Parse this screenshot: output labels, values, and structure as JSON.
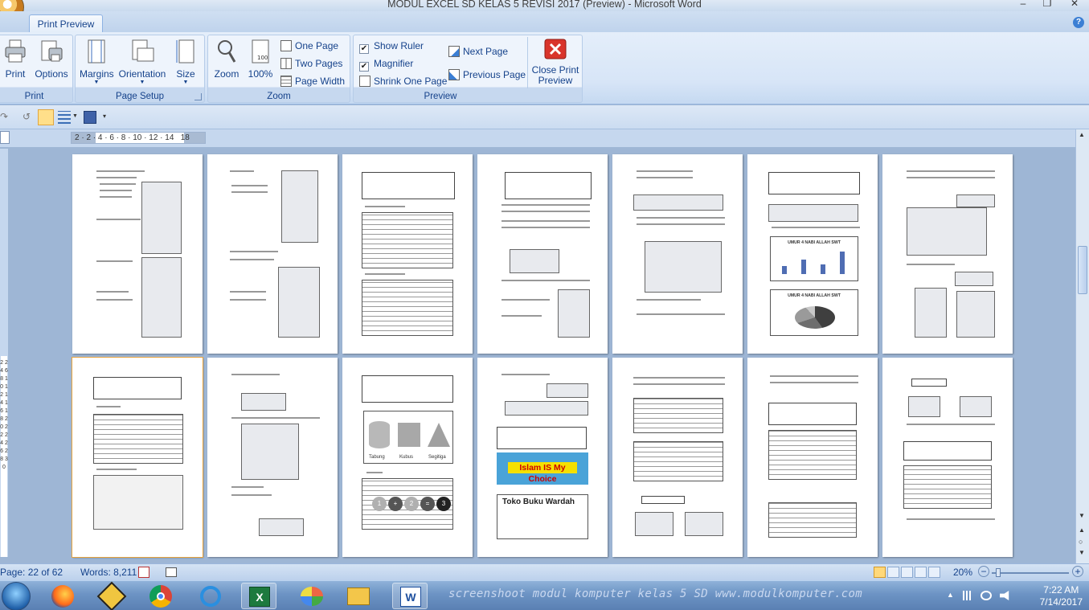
{
  "window": {
    "title": "MODUL EXCEL SD KELAS 5 REVISI 2017 (Preview) - Microsoft Word",
    "minimize": "–",
    "maximize": "❐",
    "close": "✕"
  },
  "ribbon": {
    "active_tab": "Print Preview",
    "help": "?",
    "groups": {
      "print": {
        "label": "Print",
        "print_button": "Print",
        "options_button": "Options"
      },
      "page_setup": {
        "label": "Page Setup",
        "margins": "Margins",
        "orientation": "Orientation",
        "size": "Size"
      },
      "zoom": {
        "label": "Zoom",
        "zoom": "Zoom",
        "percent_100": "100%",
        "one_page": "One Page",
        "two_pages": "Two Pages",
        "page_width": "Page Width"
      },
      "preview": {
        "label": "Preview",
        "show_ruler": "Show Ruler",
        "show_ruler_checked": true,
        "magnifier": "Magnifier",
        "magnifier_checked": true,
        "shrink_one_page": "Shrink One Page",
        "next_page": "Next Page",
        "previous_page": "Previous Page",
        "close_print_preview_1": "Close Print",
        "close_print_preview_2": "Preview"
      }
    }
  },
  "ruler": {
    "ticks": "2 · 2 · 4 · 6 · 8 · 10 · 12 · 14   18"
  },
  "vruler": {
    "ticks": "2 2 4 6 8 10 12 14 16 18 20 22 24 26 28 30"
  },
  "pages": {
    "row2_banner_text": "Islam IS My Choice",
    "row2_store_title": "Toko Buku Wardah",
    "shape_labels": [
      "Tabung",
      "Kubus",
      "Segitiga"
    ],
    "equation": [
      "1",
      "+",
      "2",
      "=",
      "3"
    ],
    "chart_title": "UMUR 4 NABI ALLAH SWT"
  },
  "statusbar": {
    "page": "Page: 22 of 62",
    "words": "Words: 8,211",
    "zoom": "20%",
    "zoom_out": "−",
    "zoom_in": "+"
  },
  "taskbar": {
    "watermark": "screenshoot modul komputer kelas 5 SD www.modulkomputer.com",
    "time": "7:22 AM",
    "date": "7/14/2017"
  },
  "colors": {
    "ribbon_text": "#15428b",
    "doc_background": "#9eb6d5",
    "banner_yellow": "#f5e000",
    "banner_blue": "#4aa3d8"
  }
}
